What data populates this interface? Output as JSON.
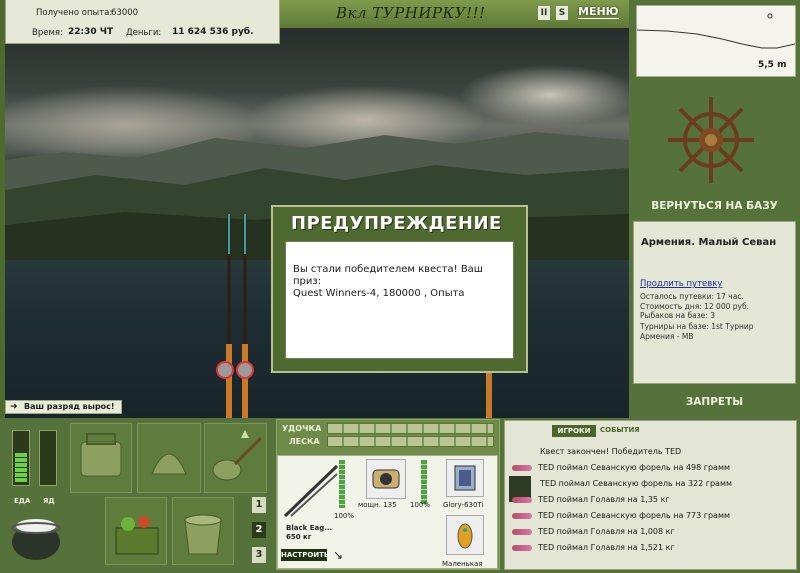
{
  "header": {
    "exp_label": "Получено опыта:",
    "exp_value": "63000",
    "time_label": "Время:",
    "time_value": "22:30 ЧТ",
    "money_label": "Деньги:",
    "money_value": "11 624 536 руб.",
    "tournament": "Вкл ТУРНИРКУ!!!",
    "pause_label": "II",
    "sound_label": "S",
    "menu_label": "МЕНЮ"
  },
  "depth": {
    "value": "5,5 m"
  },
  "right": {
    "return_label": "ВЕРНУТЬСЯ НА БАЗУ",
    "location": "Армения. Малый Севан",
    "extend_link": "Продлить путевку",
    "info": [
      "Осталось путевки: 17 час.",
      "Стоимость дня: 12 000 руб.",
      "Рыбаков на базе: 3",
      "Турниры на базе: 1st Турнир",
      "Армения - MB"
    ],
    "bans_label": "ЗАПРЕТЫ"
  },
  "dialog": {
    "title": "ПРЕДУПРЕЖДЕНИЕ",
    "message_line1": "Вы стали победителем квеста! Ваш приз:",
    "message_line2": "Quest Winners-4, 180000 , Опыта"
  },
  "rank_notice": "Ваш разряд вырос!",
  "status": {
    "food_label": "ЕДА",
    "poison_label": "ЯД",
    "food_level": 0.55,
    "poison_level": 0.0
  },
  "slots": {
    "numbers": [
      "1",
      "2",
      "3"
    ]
  },
  "tackle": {
    "rod_label": "УДОЧКА",
    "line_label": "ЛЕСКА",
    "rod_name": "Black Eag...",
    "rod_weight": "650 кг",
    "rod_percent": "100%",
    "reel_power": "мощн. 135",
    "reel_percent": "100%",
    "line_name": "Glory-630Ti",
    "lure_name": "Маленькая",
    "setup_button": "НАСТРОИТЬ"
  },
  "feed": {
    "tab_players": "ИГРОКИ",
    "tab_events": "СОБЫТИЯ",
    "header": "Квест закончен! Победитель TED",
    "entries": [
      "TED поймал Севанскую форель на 498 грамм",
      "TED поймал Севанскую форель на 322 грамм",
      "TED поймал Голавля на 1,35 кг",
      "TED поймал Севанскую форель на 773 грамм",
      "TED поймал Голавля на 1,008 кг",
      "TED поймал Голавля на 1,521 кг"
    ]
  }
}
